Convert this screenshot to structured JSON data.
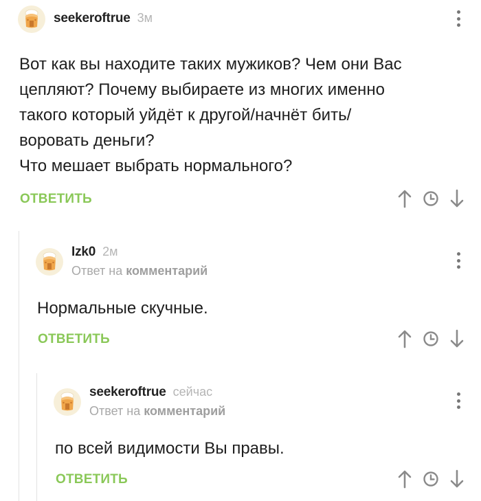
{
  "colors": {
    "accent": "#8ac858",
    "muted": "#b5b5b5",
    "text": "#1e1e1e",
    "icon": "#8a8a8a"
  },
  "icons": [
    "avatar-icon",
    "more-vertical-icon",
    "arrow-up-icon",
    "clock-icon",
    "arrow-down-icon"
  ],
  "comments": [
    {
      "username": "seekeroftrue",
      "time": "3м",
      "text_lines": [
        "Вот как вы находите таких мужиков? Чем они Вас",
        "цепляют? Почему выбираете из многих именно",
        "такого который уйдёт к другой/начнёт бить/",
        "воровать деньги?",
        "Что мешает выбрать нормального?"
      ],
      "reply_label": "ОТВЕТИТЬ"
    },
    {
      "username": "Izk0",
      "time": "2м",
      "reply_prefix": "Ответ на",
      "reply_target": "комментарий",
      "text_lines": [
        "Нормальные скучные."
      ],
      "reply_label": "ОТВЕТИТЬ"
    },
    {
      "username": "seekeroftrue",
      "time": "сейчас",
      "reply_prefix": "Ответ на",
      "reply_target": "комментарий",
      "text_lines": [
        "по всей видимости Вы правы."
      ],
      "reply_label": "ОТВЕТИТЬ"
    }
  ]
}
